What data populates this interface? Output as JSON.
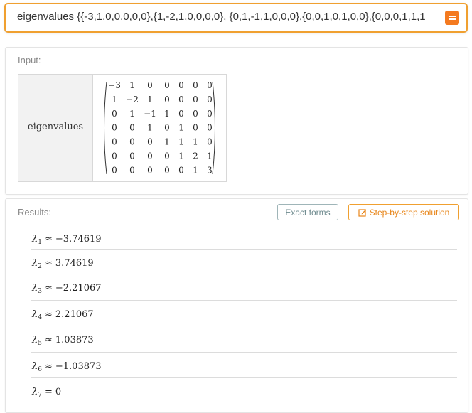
{
  "query": {
    "text": "eigenvalues {{-3,1,0,0,0,0,0},{1,-2,1,0,0,0,0}, {0,1,-1,1,0,0,0},{0,0,1,0,1,0,0},{0,0,0,1,1,1",
    "submit_icon": "equals-icon"
  },
  "input_pod": {
    "label": "Input:",
    "function_name": "eigenvalues",
    "matrix": [
      [
        "−3",
        "1",
        "0",
        "0",
        "0",
        "0",
        "0"
      ],
      [
        "1",
        "−2",
        "1",
        "0",
        "0",
        "0",
        "0"
      ],
      [
        "0",
        "1",
        "−1",
        "1",
        "0",
        "0",
        "0"
      ],
      [
        "0",
        "0",
        "1",
        "0",
        "1",
        "0",
        "0"
      ],
      [
        "0",
        "0",
        "0",
        "1",
        "1",
        "1",
        "0"
      ],
      [
        "0",
        "0",
        "0",
        "0",
        "1",
        "2",
        "1"
      ],
      [
        "0",
        "0",
        "0",
        "0",
        "0",
        "1",
        "3"
      ]
    ]
  },
  "results_pod": {
    "label": "Results:",
    "exact_forms_label": "Exact forms",
    "step_by_step_label": "Step-by-step solution",
    "step_icon": "edit-icon",
    "results": [
      {
        "symbol": "λ",
        "index": "1",
        "relation": "≈",
        "value": "−3.74619"
      },
      {
        "symbol": "λ",
        "index": "2",
        "relation": "≈",
        "value": "3.74619"
      },
      {
        "symbol": "λ",
        "index": "3",
        "relation": "≈",
        "value": "−2.21067"
      },
      {
        "symbol": "λ",
        "index": "4",
        "relation": "≈",
        "value": "2.21067"
      },
      {
        "symbol": "λ",
        "index": "5",
        "relation": "≈",
        "value": "1.03873"
      },
      {
        "symbol": "λ",
        "index": "6",
        "relation": "≈",
        "value": "−1.03873"
      },
      {
        "symbol": "λ",
        "index": "7",
        "relation": "=",
        "value": "0"
      }
    ]
  }
}
